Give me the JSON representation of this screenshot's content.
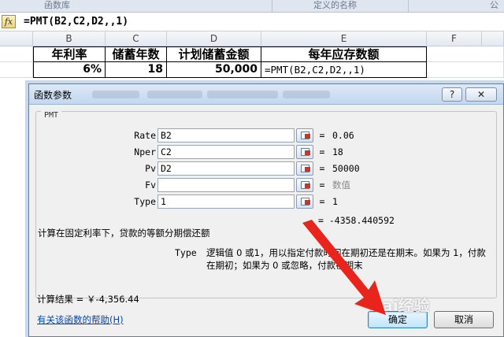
{
  "ribbon": {
    "left_label": "函数库",
    "mid_label": "定义的名称",
    "right_label": "公"
  },
  "formula_bar": {
    "fx_icon": "fx-icon",
    "fx_label": "fx",
    "formula": "=PMT(B2,C2,D2,,1)"
  },
  "sheet": {
    "columns": [
      "B",
      "C",
      "D",
      "E",
      "F"
    ],
    "headers": [
      "年利率",
      "储蓄年数",
      "计划储蓄金额",
      "每年应存数额"
    ],
    "values": [
      "6%",
      "18",
      "50,000",
      "=PMT(B2,C2,D2,,1)"
    ]
  },
  "dialog": {
    "title": "函数参数",
    "help_button": "?",
    "close_button": "✕",
    "function_name": "PMT",
    "params": [
      {
        "label": "Rate",
        "value": "B2",
        "result": "0.06"
      },
      {
        "label": "Nper",
        "value": "C2",
        "result": "18"
      },
      {
        "label": "Pv",
        "value": "D2",
        "result": "50000"
      },
      {
        "label": "Fv",
        "value": "",
        "result": "数值"
      },
      {
        "label": "Type",
        "value": "1",
        "result": "1"
      }
    ],
    "equals": "=",
    "formula_result": "= -4358.440592",
    "description": "计算在固定利率下，贷款的等额分期偿还额",
    "arg_name": "Type",
    "arg_description": "逻辑值 0 或1，用以指定付款时间在期初还是在期末。如果为 1，付款在期初；如果为 0 或忽略，付款在期末",
    "calc_result": "计算结果 = ￥-4,356.44",
    "help_link": "有关该函数的帮助(H)",
    "ok_button": "确定",
    "cancel_button": "取消"
  },
  "watermark": "Bai经验",
  "colors": {
    "accent": "#3c7fb1",
    "arrow": "#e8241c",
    "link": "#0645ad"
  }
}
